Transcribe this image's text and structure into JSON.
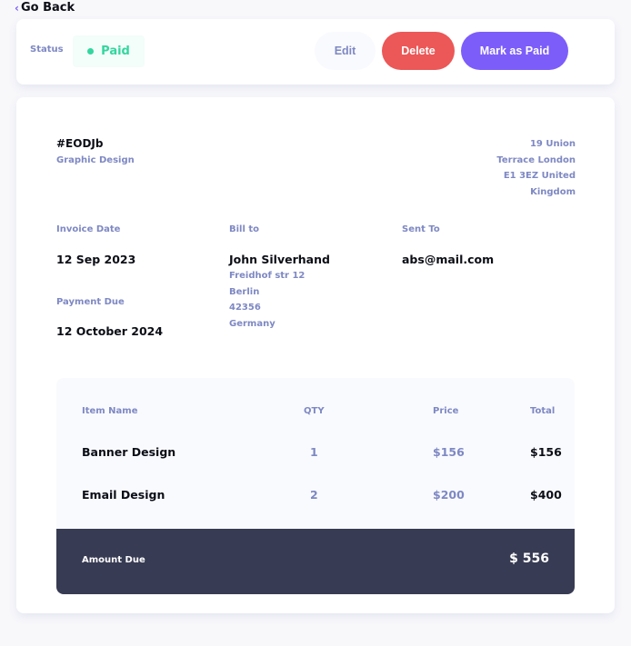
{
  "nav": {
    "back_label": "Go Back"
  },
  "status_bar": {
    "label": "Status",
    "status": "Paid",
    "actions": {
      "edit": "Edit",
      "delete": "Delete",
      "mark_paid": "Mark as Paid"
    }
  },
  "invoice": {
    "id": "#EODJb",
    "description": "Graphic Design",
    "sender_address": [
      "19 Union",
      "Terrace London",
      "E1 3EZ United",
      "Kingdom"
    ],
    "invoice_date_label": "Invoice Date",
    "invoice_date": "12 Sep 2023",
    "payment_due_label": "Payment Due",
    "payment_due": "12 October 2024",
    "bill_to_label": "Bill to",
    "client_name": "John Silverhand",
    "client_address": [
      "Freidhof str 12",
      "Berlin",
      "42356",
      "Germany"
    ],
    "sent_to_label": "Sent To",
    "client_email": "abs@mail.com"
  },
  "items": {
    "headers": {
      "name": "Item Name",
      "qty": "QTY",
      "price": "Price",
      "total": "Total"
    },
    "rows": [
      {
        "name": "Banner Design",
        "qty": "1",
        "price": "$156",
        "total": "$156"
      },
      {
        "name": "Email Design",
        "qty": "2",
        "price": "$200",
        "total": "$400"
      }
    ],
    "amount_due_label": "Amount Due",
    "amount_due": "$ 556"
  },
  "colors": {
    "accent": "#7c5dfa",
    "danger": "#ec5757",
    "paid": "#33d69f",
    "muted_text": "#7e88c3",
    "dark_panel": "#373b53"
  }
}
